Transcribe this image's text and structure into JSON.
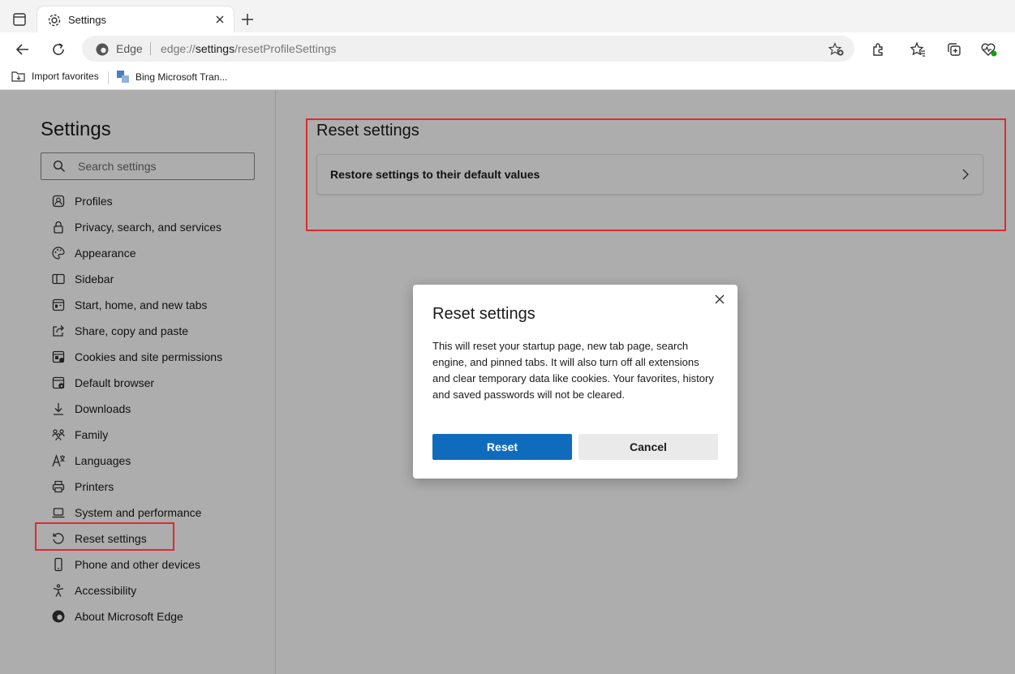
{
  "tab": {
    "title": "Settings"
  },
  "address": {
    "site_label": "Edge",
    "url_prefix": "edge://",
    "url_bold": "settings",
    "url_rest": "/resetProfileSettings"
  },
  "favorites": [
    {
      "label": "Import favorites"
    },
    {
      "label": "Bing Microsoft Tran..."
    }
  ],
  "sidebar": {
    "title": "Settings",
    "search_placeholder": "Search settings",
    "items": [
      {
        "label": "Profiles",
        "icon": "profile-icon"
      },
      {
        "label": "Privacy, search, and services",
        "icon": "lock-icon"
      },
      {
        "label": "Appearance",
        "icon": "palette-icon"
      },
      {
        "label": "Sidebar",
        "icon": "sidebar-icon"
      },
      {
        "label": "Start, home, and new tabs",
        "icon": "home-tabs-icon"
      },
      {
        "label": "Share, copy and paste",
        "icon": "share-icon"
      },
      {
        "label": "Cookies and site permissions",
        "icon": "cookies-icon"
      },
      {
        "label": "Default browser",
        "icon": "browser-icon"
      },
      {
        "label": "Downloads",
        "icon": "download-icon"
      },
      {
        "label": "Family",
        "icon": "family-icon"
      },
      {
        "label": "Languages",
        "icon": "languages-icon"
      },
      {
        "label": "Printers",
        "icon": "printer-icon"
      },
      {
        "label": "System and performance",
        "icon": "laptop-icon"
      },
      {
        "label": "Reset settings",
        "icon": "reset-icon"
      },
      {
        "label": "Phone and other devices",
        "icon": "phone-icon"
      },
      {
        "label": "Accessibility",
        "icon": "accessibility-icon"
      },
      {
        "label": "About Microsoft Edge",
        "icon": "edge-logo-icon"
      }
    ]
  },
  "main": {
    "title": "Reset settings",
    "restore_label": "Restore settings to their default values"
  },
  "dialog": {
    "title": "Reset settings",
    "body": "This will reset your startup page, new tab page, search engine, and pinned tabs. It will also turn off all extensions and clear temporary data like cookies. Your favorites, history and saved passwords will not be cleared.",
    "reset_label": "Reset",
    "cancel_label": "Cancel"
  },
  "colors": {
    "accent": "#0f6cbd",
    "highlight": "#e0292e"
  }
}
